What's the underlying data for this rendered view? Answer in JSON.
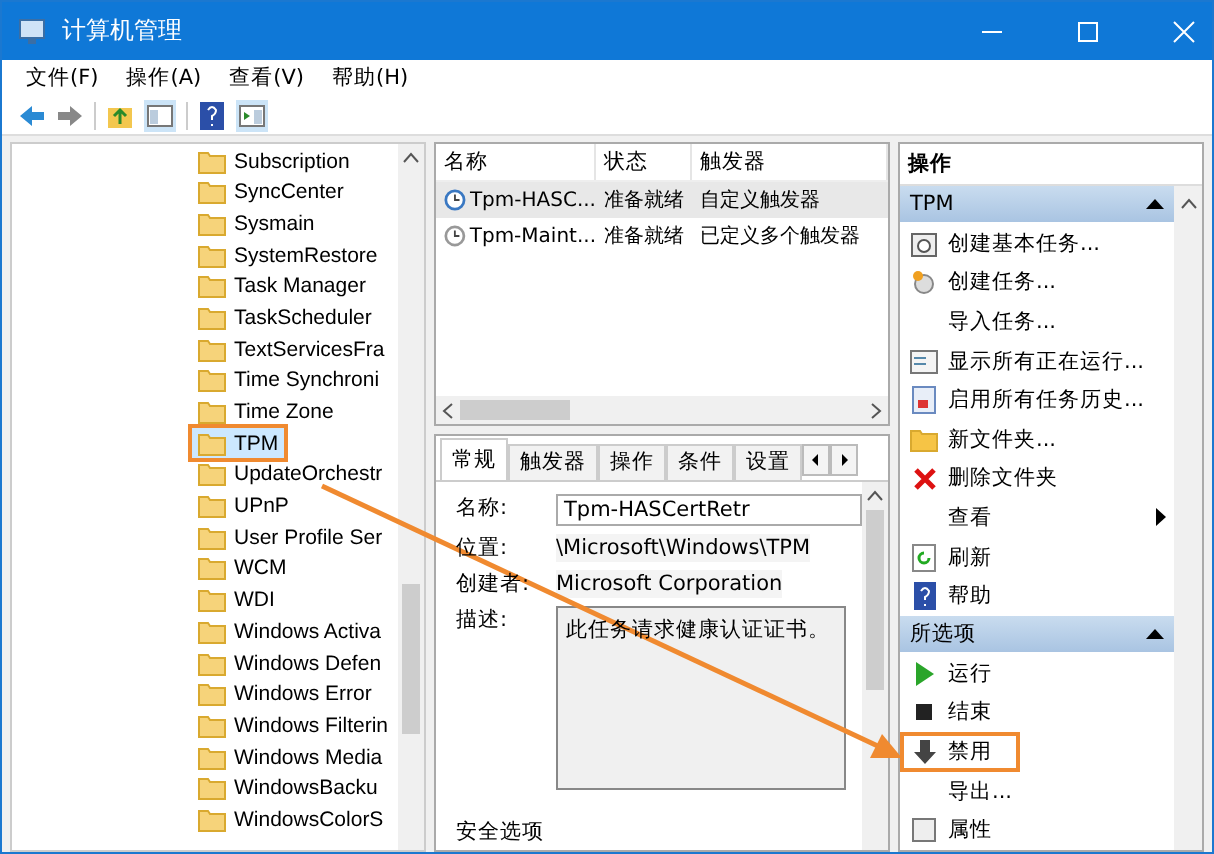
{
  "window": {
    "title": "计算机管理"
  },
  "menu": [
    {
      "label": "文件(F)"
    },
    {
      "label": "操作(A)"
    },
    {
      "label": "查看(V)"
    },
    {
      "label": "帮助(H)"
    }
  ],
  "tree": {
    "items": [
      {
        "label": "Subscription",
        "selected": false,
        "annotated": false
      },
      {
        "label": "SyncCenter",
        "selected": false,
        "annotated": false
      },
      {
        "label": "Sysmain",
        "selected": false,
        "annotated": false
      },
      {
        "label": "SystemRestore",
        "selected": false,
        "annotated": false
      },
      {
        "label": "Task Manager",
        "selected": false,
        "annotated": false
      },
      {
        "label": "TaskScheduler",
        "selected": false,
        "annotated": false
      },
      {
        "label": "TextServicesFra",
        "selected": false,
        "annotated": false
      },
      {
        "label": "Time Synchroni",
        "selected": false,
        "annotated": false
      },
      {
        "label": "Time Zone",
        "selected": false,
        "annotated": false
      },
      {
        "label": "TPM",
        "selected": true,
        "annotated": true
      },
      {
        "label": "UpdateOrchestr",
        "selected": false,
        "annotated": false
      },
      {
        "label": "UPnP",
        "selected": false,
        "annotated": false
      },
      {
        "label": "User Profile Ser",
        "selected": false,
        "annotated": false
      },
      {
        "label": "WCM",
        "selected": false,
        "annotated": false
      },
      {
        "label": "WDI",
        "selected": false,
        "annotated": false
      },
      {
        "label": "Windows Activa",
        "selected": false,
        "annotated": false
      },
      {
        "label": "Windows Defen",
        "selected": false,
        "annotated": false
      },
      {
        "label": "Windows Error",
        "selected": false,
        "annotated": false
      },
      {
        "label": "Windows Filterin",
        "selected": false,
        "annotated": false
      },
      {
        "label": "Windows Media",
        "selected": false,
        "annotated": false
      },
      {
        "label": "WindowsBacku",
        "selected": false,
        "annotated": false
      },
      {
        "label": "WindowsColorS",
        "selected": false,
        "annotated": false
      }
    ]
  },
  "task_list": {
    "columns": [
      "名称",
      "状态",
      "触发器"
    ],
    "rows": [
      {
        "name": "Tpm-HASC...",
        "status": "准备就绪",
        "trigger": "自定义触发器",
        "selected": true
      },
      {
        "name": "Tpm-Maint...",
        "status": "准备就绪",
        "trigger": "已定义多个触发器",
        "selected": false
      }
    ]
  },
  "tabs": [
    {
      "label": "常规",
      "selected": true
    },
    {
      "label": "触发器",
      "selected": false
    },
    {
      "label": "操作",
      "selected": false
    },
    {
      "label": "条件",
      "selected": false
    },
    {
      "label": "设置",
      "selected": false
    }
  ],
  "details": {
    "fields": [
      {
        "label": "名称:",
        "value": "Tpm-HASCertRetr",
        "kind": "input"
      },
      {
        "label": "位置:",
        "value": "\\Microsoft\\Windows\\TPM",
        "kind": "text"
      },
      {
        "label": "创建者:",
        "value": "Microsoft Corporation",
        "kind": "text"
      },
      {
        "label": "描述:",
        "value": "此任务请求健康认证证书。",
        "kind": "textarea"
      }
    ],
    "section": "安全选项"
  },
  "actions": {
    "title": "操作",
    "groups": [
      {
        "title": "TPM",
        "items": [
          {
            "label": "创建基本任务...",
            "kind": "basic-task",
            "annotated": false
          },
          {
            "label": "创建任务...",
            "kind": "task",
            "annotated": false
          },
          {
            "label": "导入任务...",
            "kind": "none",
            "annotated": false
          },
          {
            "label": "显示所有正在运行...",
            "kind": "running",
            "annotated": false
          },
          {
            "label": "启用所有任务历史...",
            "kind": "history",
            "annotated": false
          },
          {
            "label": "新文件夹...",
            "kind": "folder",
            "annotated": false
          },
          {
            "label": "删除文件夹",
            "kind": "delete",
            "annotated": false
          },
          {
            "label": "查看",
            "kind": "submenu",
            "annotated": false
          },
          {
            "label": "刷新",
            "kind": "refresh",
            "annotated": false
          },
          {
            "label": "帮助",
            "kind": "help",
            "annotated": false
          }
        ]
      },
      {
        "title": "所选项",
        "items": [
          {
            "label": "运行",
            "kind": "run",
            "annotated": false
          },
          {
            "label": "结束",
            "kind": "end",
            "annotated": false
          },
          {
            "label": "禁用",
            "kind": "disable",
            "annotated": true
          },
          {
            "label": "导出...",
            "kind": "none",
            "annotated": false
          },
          {
            "label": "属性",
            "kind": "properties",
            "annotated": false
          }
        ]
      }
    ]
  }
}
